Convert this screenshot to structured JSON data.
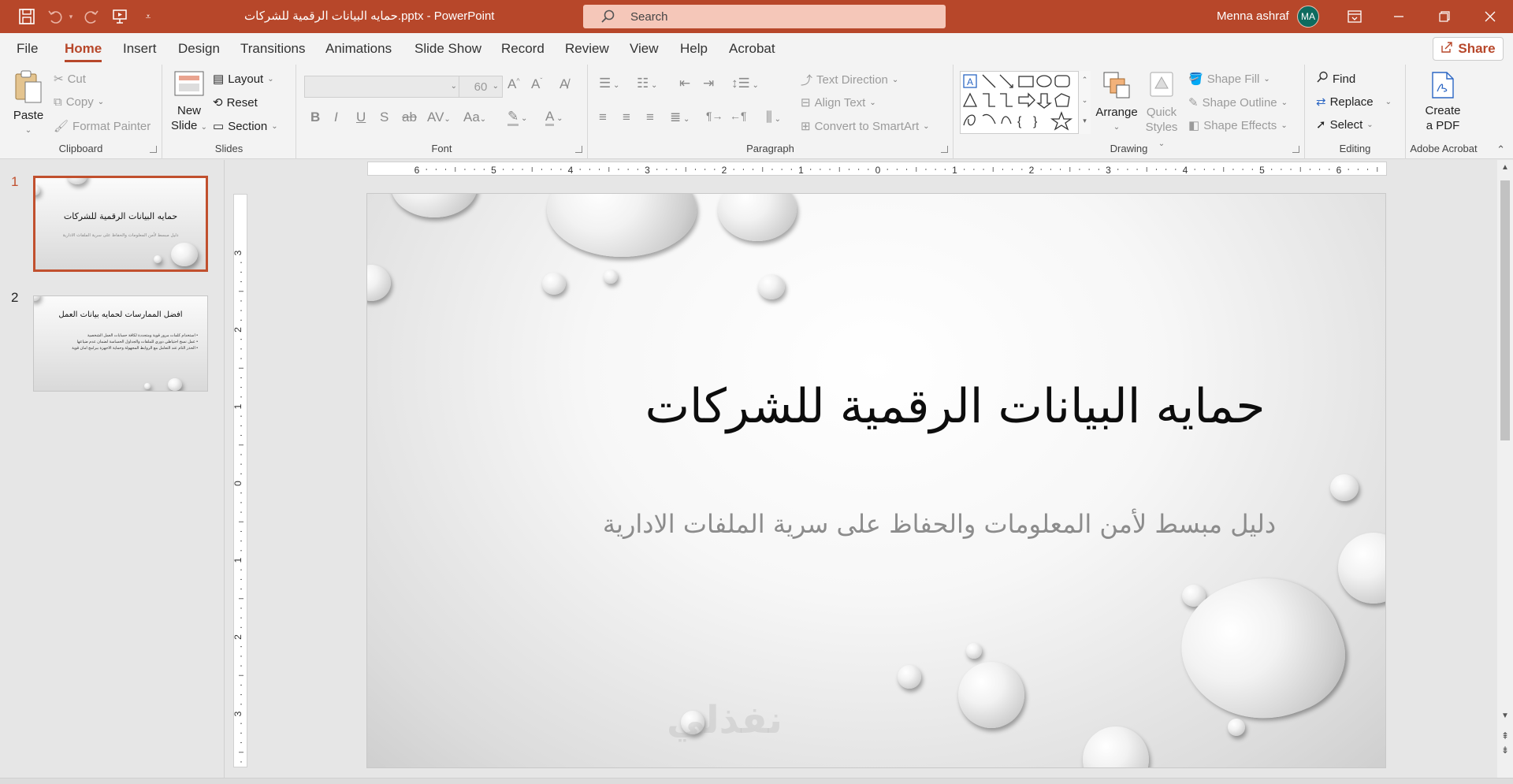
{
  "titlebar": {
    "doc_title": "حمايه البيانات الرقمية للشركات.pptx  -  PowerPoint",
    "search_placeholder": "Search",
    "user_name": "Menna ashraf",
    "user_initials": "MA"
  },
  "menu": {
    "tabs": [
      "File",
      "Home",
      "Insert",
      "Design",
      "Transitions",
      "Animations",
      "Slide Show",
      "Record",
      "Review",
      "View",
      "Help",
      "Acrobat"
    ],
    "active_tab": "Home",
    "share_label": "Share"
  },
  "ribbon": {
    "clipboard": {
      "label": "Clipboard",
      "paste": "Paste",
      "cut": "Cut",
      "copy": "Copy",
      "format_painter": "Format Painter"
    },
    "slides": {
      "label": "Slides",
      "new_slide_line1": "New",
      "new_slide_line2": "Slide",
      "layout": "Layout",
      "reset": "Reset",
      "section": "Section"
    },
    "font": {
      "label": "Font",
      "font_name": "",
      "font_size": "60",
      "bold": "B",
      "italic": "I",
      "underline": "U",
      "shadow": "S",
      "strike": "ab",
      "spacing": "AV",
      "case": "Aa"
    },
    "paragraph": {
      "label": "Paragraph",
      "text_direction": "Text Direction",
      "align_text": "Align Text",
      "convert_smartart": "Convert to SmartArt"
    },
    "drawing": {
      "label": "Drawing",
      "arrange": "Arrange",
      "quick_styles_line1": "Quick",
      "quick_styles_line2": "Styles",
      "shape_fill": "Shape Fill",
      "shape_outline": "Shape Outline",
      "shape_effects": "Shape Effects"
    },
    "editing": {
      "label": "Editing",
      "find": "Find",
      "replace": "Replace",
      "select": "Select"
    },
    "acrobat": {
      "label": "Adobe Acrobat",
      "create_line1": "Create",
      "create_line2": "a PDF"
    }
  },
  "slides": [
    {
      "number": "1",
      "title": "حمايه البيانات الرقمية للشركات",
      "subtitle": "دليل مبسط لأمن المعلومات والحفاظ على سرية الملفات الادارية"
    },
    {
      "number": "2",
      "title": "افضل الممارسات لحمايه بيانات العمل",
      "bullets": [
        "• استخدام كلمات مرور قوية ومتجددة لكافة حسابات العمل الشخصية",
        "• عمل نسخ احتياطي دوري للملفات والجداول الحساسة لضمان عدم ضياعها",
        "• الحذر التام عند التعامل مع الروابط المجهولة وحماية الاجهزة ببرامج امان قوية"
      ]
    }
  ],
  "rulers": {
    "horizontal_labels": [
      "6",
      "5",
      "4",
      "3",
      "2",
      "1",
      "0",
      "1",
      "2",
      "3",
      "4",
      "5",
      "6"
    ],
    "vertical_labels": [
      "3",
      "2",
      "1",
      "0",
      "1",
      "2",
      "3"
    ]
  },
  "watermark": "نفذلي"
}
